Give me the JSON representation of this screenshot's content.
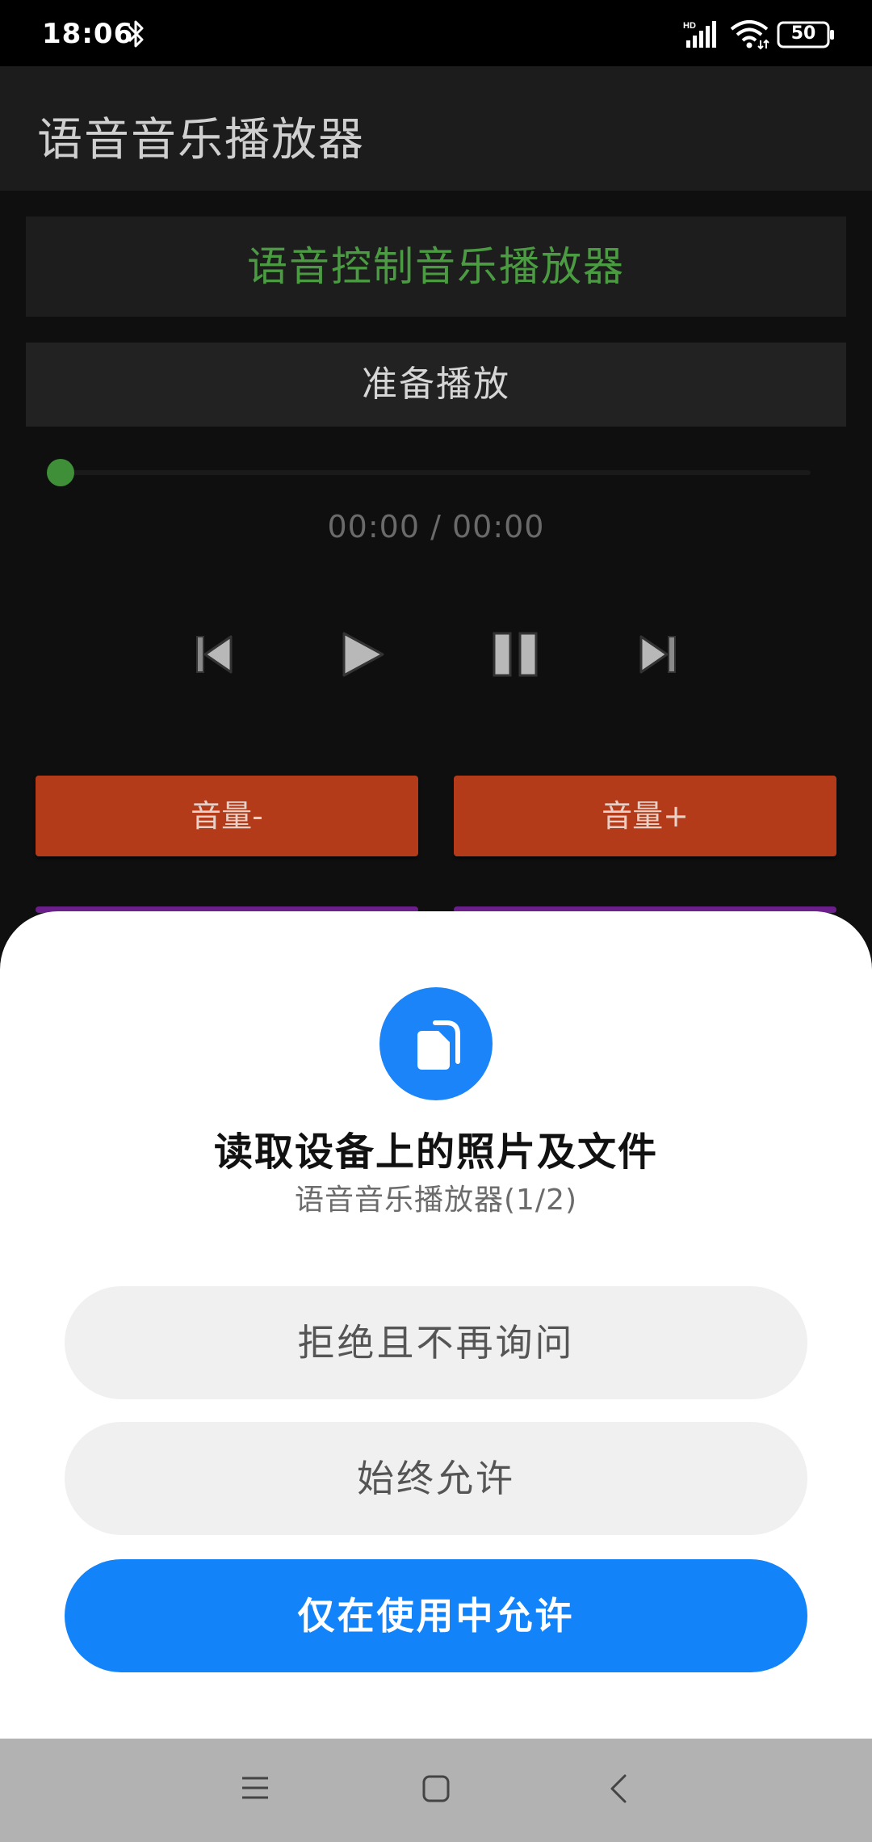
{
  "status_bar": {
    "time": "18:06",
    "battery": "50",
    "icons": [
      "bluetooth-icon",
      "hd-signal-icon",
      "wifi-icon",
      "battery-icon"
    ]
  },
  "app_bar": {
    "title": "语音音乐播放器"
  },
  "player": {
    "header": "语音控制音乐播放器",
    "status": "准备播放",
    "time_display": "00:00 / 00:00",
    "progress": 0,
    "controls": [
      "previous-icon",
      "play-icon",
      "pause-icon",
      "next-icon"
    ],
    "volume_down_label": "音量-",
    "volume_up_label": "音量+",
    "accent_color": "#4a9b41",
    "volume_button_color": "#b33b1a"
  },
  "permission_dialog": {
    "icon": "file-icon",
    "title": "读取设备上的照片及文件",
    "subtitle": "语音音乐播放器(1/2)",
    "deny_label": "拒绝且不再询问",
    "always_label": "始终允许",
    "while_using_label": "仅在使用中允许",
    "primary_color": "#1283f8"
  },
  "nav_bar": {
    "icons": [
      "menu-icon",
      "home-icon",
      "back-icon"
    ]
  }
}
